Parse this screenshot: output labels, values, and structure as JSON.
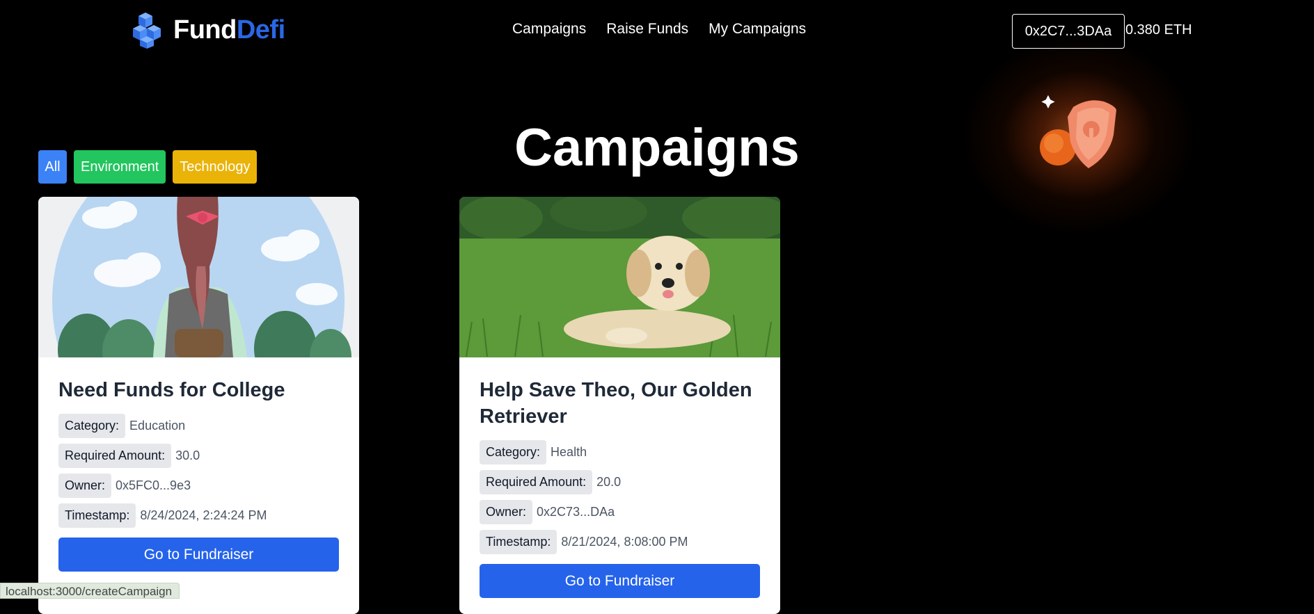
{
  "header": {
    "logo_part1": "Fund",
    "logo_part2": "Defi",
    "nav": [
      "Campaigns",
      "Raise Funds",
      "My Campaigns"
    ],
    "wallet_address": "0x2C7...3DAa",
    "balance": "0.380 ETH"
  },
  "page_title": "Campaigns",
  "filters": [
    "All",
    "Environment",
    "Technology"
  ],
  "campaigns": [
    {
      "title": "Need Funds for College",
      "category_label": "Category:",
      "category": "Education",
      "amount_label": "Required Amount:",
      "amount": "30.0",
      "owner_label": "Owner:",
      "owner": "0x5FC0...9e3",
      "timestamp_label": "Timestamp:",
      "timestamp": "8/24/2024, 2:24:24 PM",
      "cta": "Go to Fundraiser",
      "image": "girl-backpack-illustration"
    },
    {
      "title": "Help Save Theo, Our Golden Retriever",
      "category_label": "Category:",
      "category": "Health",
      "amount_label": "Required Amount:",
      "amount": "20.0",
      "owner_label": "Owner:",
      "owner": "0x2C73...DAa",
      "timestamp_label": "Timestamp:",
      "timestamp": "8/21/2024, 8:08:00 PM",
      "cta": "Go to Fundraiser",
      "image": "golden-retriever-puppy-photo"
    }
  ],
  "statusbar_url": "localhost:3000/createCampaign",
  "colors": {
    "brand_blue": "#2a67e6",
    "filter_all": "#3b82f6",
    "filter_environment": "#22c55e",
    "filter_technology": "#eab308",
    "cta": "#2563eb",
    "glow": "#ff7a2a"
  }
}
